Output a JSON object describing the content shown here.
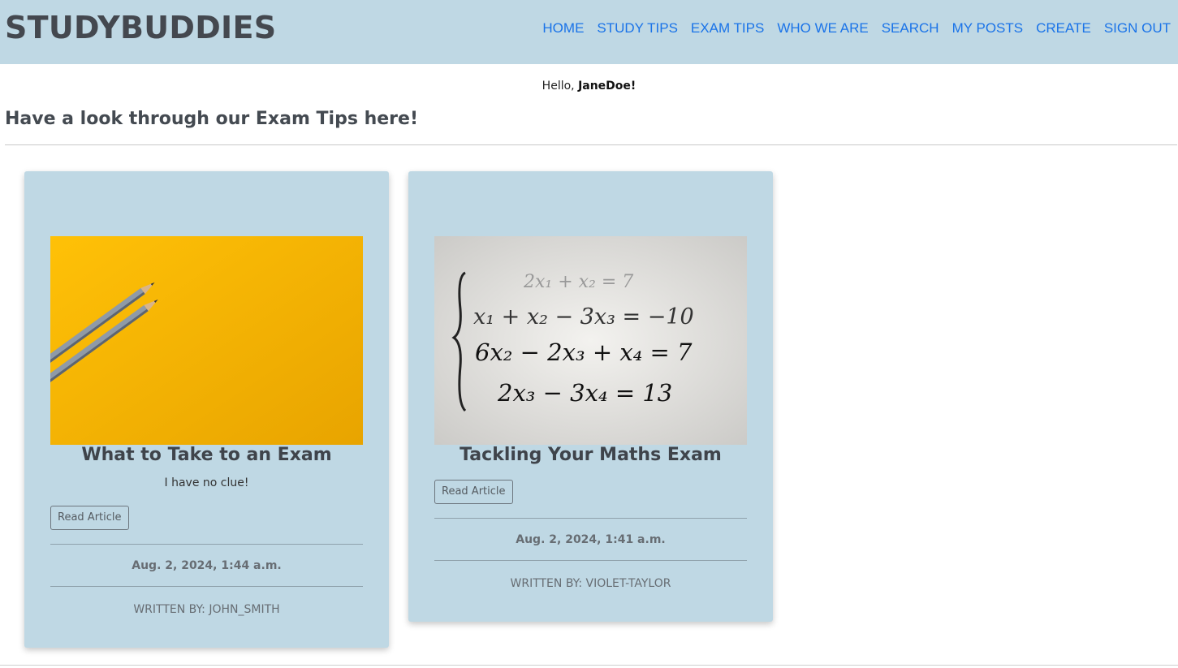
{
  "header": {
    "brand": "STUDYBUDDIES",
    "nav": [
      "HOME",
      "STUDY TIPS",
      "EXAM TIPS",
      "WHO WE ARE",
      "SEARCH",
      "MY POSTS",
      "CREATE",
      "SIGN OUT"
    ]
  },
  "greeting": {
    "prefix": "Hello, ",
    "username": "JaneDoe!"
  },
  "section_title": "Have a look through our Exam Tips here!",
  "cards": [
    {
      "title": "What to Take to an Exam",
      "excerpt": "I have no clue!",
      "button": "Read Article",
      "date": "Aug. 2, 2024, 1:44 a.m.",
      "author": "WRITTEN BY: JOHN_SMITH",
      "image_icon": "pencils-on-yellow-image"
    },
    {
      "title": "Tackling Your Maths Exam",
      "excerpt": "",
      "button": "Read Article",
      "date": "Aug. 2, 2024, 1:41 a.m.",
      "author": "WRITTEN BY: VIOLET-TAYLOR",
      "image_icon": "equations-image",
      "equations": [
        "2x₁ + x₂ = 7",
        "x₁ + x₂ − 3x₃ = −10",
        "6x₂ − 2x₃ + x₄ = 7",
        "2x₃ − 3x₄ = 13"
      ]
    }
  ],
  "colors": {
    "header_bg": "#bfd8e4",
    "card_bg": "#bfd8e4",
    "nav_link": "#1a73e8",
    "heading": "#444a51"
  }
}
